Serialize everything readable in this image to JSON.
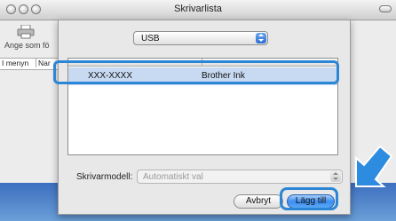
{
  "window": {
    "title": "Skrivarlista"
  },
  "toolbar": {
    "default_button_label": "Ange som fö"
  },
  "columns": {
    "col1": "I menyn",
    "col2": "Nar"
  },
  "sheet": {
    "connection_popup": {
      "value": "USB"
    },
    "printer_list": {
      "rows": [
        {
          "name": "XXX-XXXX",
          "kind": "Brother Ink"
        }
      ]
    },
    "model": {
      "label": "Skrivarmodell:",
      "value": "Automatiskt val"
    },
    "buttons": {
      "cancel": "Avbryt",
      "add": "Lägg till"
    }
  },
  "colors": {
    "accent": "#2c86d6",
    "selection": "#c8daf2",
    "desktop": "#5b8fd0"
  }
}
